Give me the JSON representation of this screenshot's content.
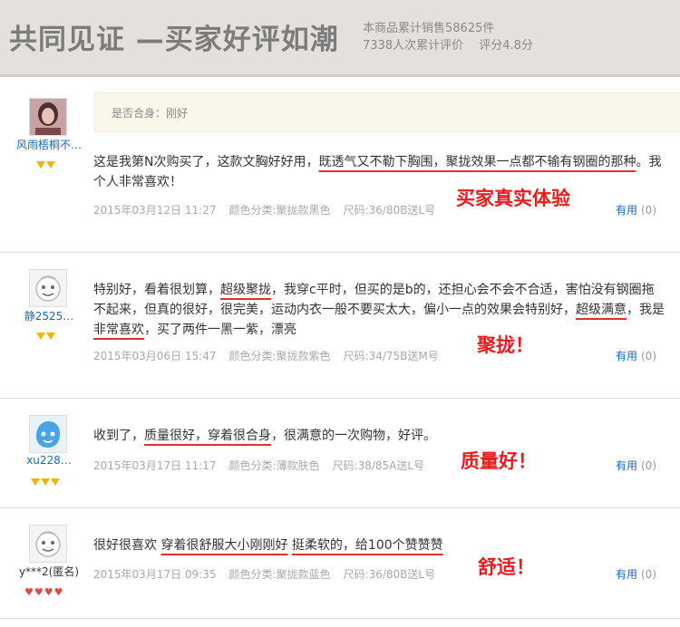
{
  "banner": {
    "title": "共同见证 —买家好评如潮",
    "stat1": "本商品累计销售58625件",
    "stat2": "7338人次累计评价　 评分4.8分"
  },
  "reviews": [
    {
      "user": "风雨梧桐不…",
      "fit": "是否合身：刚好",
      "t1": "这是我第N次购买了，这款文胸好好用，",
      "h1": "既透气又不勒下胸围，聚拢效果一点都不输有钢圈的那种",
      "t2": "。我个人非常喜欢！",
      "date": "2015年03月12日 11:27",
      "color": "颜色分类:聚拢款黑色",
      "size": "尺码:36/80B送L号",
      "useful": "有用",
      "count": "(0)",
      "annotation": "买家真实体验"
    },
    {
      "user": "静2525…",
      "t1": "特别好，看着很划算，",
      "h1": "超级聚拢",
      "t2": "，我穿c平时，但买的是b的，还担心会不会不合适，害怕没有钢圈拖不起来，但真的很好，很完美，运动内衣一般不要买太大，偏小一点的效果会特别好，",
      "h2": "超级满意",
      "t3": "，我是",
      "h3": "非常喜欢",
      "t4": "，买了两件一黑一紫，漂亮",
      "date": "2015年03月06日 15:47",
      "color": "颜色分类:聚拢款紫色",
      "size": "尺码:34/75B送M号",
      "useful": "有用",
      "count": "(0)",
      "annotation": "聚拢！"
    },
    {
      "user": "xu228…",
      "t1": "收到了，",
      "h1": "质量很好，穿着很合身",
      "t2": "，很满意的一次购物，好评。",
      "date": "2015年03月17日 11:17",
      "color": "颜色分类:薄款肤色",
      "size": "尺码:38/85A送L号",
      "useful": "有用",
      "count": "(0)",
      "annotation": "质量好！"
    },
    {
      "user": "y***2(匿名)",
      "t1": "很好很喜欢 ",
      "h1": "穿着很舒服大小刚刚好",
      "t2": " ",
      "h2": "挺柔软的，给100个赞赞赞",
      "date": "2015年03月17日 09:35",
      "color": "颜色分类:聚拢款蓝色",
      "size": "尺码:36/80B送L号",
      "useful": "有用",
      "count": "(0)",
      "annotation": "舒适！"
    }
  ]
}
